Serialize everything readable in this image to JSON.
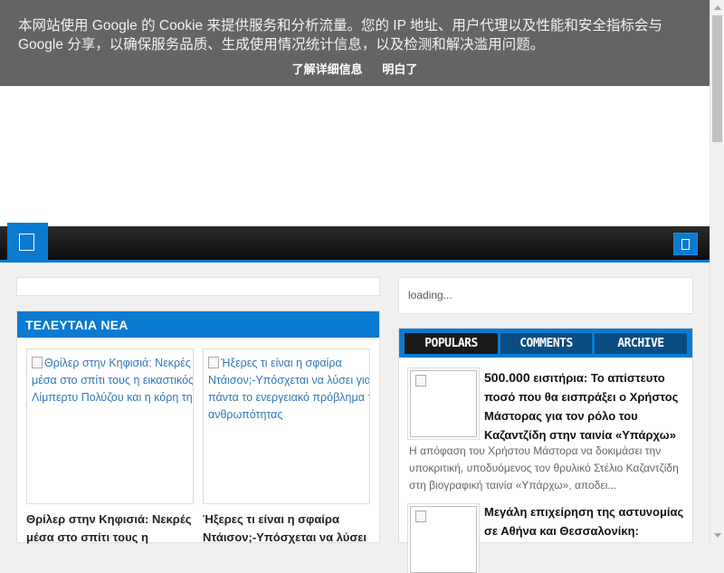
{
  "cookie_banner": {
    "message": "本网站使用 Google 的 Cookie 来提供服务和分析流量。您的 IP 地址、用户代理以及性能和安全指标会与 Google 分享，以确保服务品质、生成使用情况统计信息，以及检测和解决滥用问题。",
    "learn_more_label": "了解详细信息",
    "accept_label": "明白了"
  },
  "nav": {
    "home_icon": "home-icon",
    "search_icon": "search-icon",
    "accent_color": "#0b7ad1"
  },
  "sidebar_ad": {
    "loading_text": "loading..."
  },
  "latest_news": {
    "heading": "ΤΕΛΕΥΤΑΙΑ ΝΕΑ",
    "cards": [
      {
        "image_alt": "Θρίλερ στην Κηφισιά: Νεκρές μέσα στο σπίτι τους η εικαστικός Λίμπερτυ Πολύζου και η κόρη της",
        "title": "Θρίλερ στην Κηφισιά: Νεκρές μέσα στο σπίτι τους η"
      },
      {
        "image_alt": "Ήξερες τι είναι η σφαίρα Ντάισον;-Υπόσχεται να λύσει για πάντα το ενεργειακό πρόβλημα της ανθρωπότητας",
        "title": "Ήξερες τι είναι η σφαίρα Ντάισον;-Υπόσχεται να λύσει"
      }
    ]
  },
  "tabs_widget": {
    "tabs": [
      "POPULARS",
      "COMMENTS",
      "ARCHIVE"
    ],
    "active_tab": "POPULARS",
    "items": [
      {
        "title_lead": "500.000",
        "title_rest": " εισιτήρια: Το απίστευτο ποσό που θα εισπράξει ο Χρήστος Μάστορας για τον ρόλο του Καζαντζίδη στην ταινία «Υπάρχω»",
        "snippet": "Η απόφαση του Χρήστου Μάστορα να δοκιμάσει την υποκριτική, υποδυόμενος τον θρυλικό Στέλιο Καζαντζίδη στη βιογραφική ταινία «Υπάρχω», αποδει..."
      },
      {
        "title_lead": "",
        "title_rest": "Μεγάλη επιχείρηση της αστυνομίας σε Αθήνα και Θεσσαλονίκη:",
        "snippet": ""
      }
    ]
  }
}
